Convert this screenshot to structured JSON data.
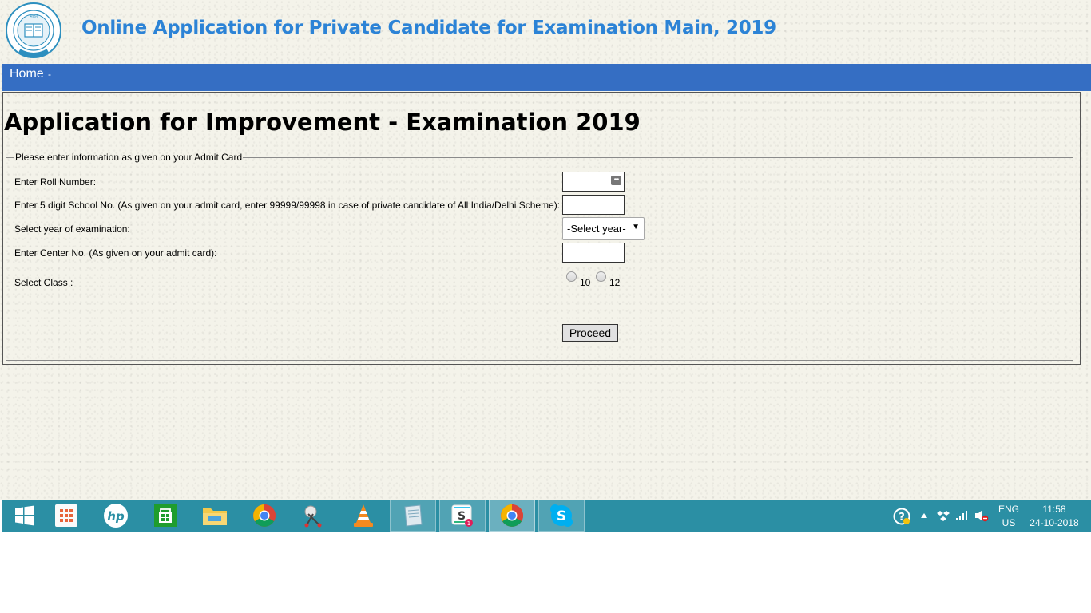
{
  "header": {
    "logo_text": "भारत",
    "title": "Online Application for Private Candidate for Examination Main, 2019"
  },
  "nav": {
    "home": "Home",
    "separator": "-"
  },
  "main": {
    "heading": "Application for Improvement - Examination 2019",
    "legend": "Please enter information as given on your Admit Card",
    "fields": {
      "roll_label": "Enter Roll Number:",
      "roll_value": "",
      "school_label": "Enter 5 digit School No. (As given on your admit card, enter 99999/99998 in case of private candidate of All India/Delhi Scheme):",
      "school_value": "",
      "year_label": "Select year of examination:",
      "year_selected": "-Select year-",
      "center_label": "Enter Center No. (As given on your admit card):",
      "center_value": "",
      "class_label": "Select Class :",
      "class_options": [
        "10",
        "12"
      ]
    },
    "proceed_label": "Proceed"
  },
  "taskbar": {
    "items": [
      "start",
      "apps",
      "hp",
      "store",
      "file-explorer",
      "chrome",
      "snipping-tool",
      "vlc",
      "notes",
      "slack",
      "chrome-active",
      "skype"
    ],
    "slack_badge": "1",
    "lang_top": "ENG",
    "lang_bottom": "US",
    "time": "11:58",
    "date": "24-10-2018"
  },
  "colors": {
    "title_blue": "#2c83d6",
    "nav_blue": "#356ec3",
    "taskbar": "#2b8fa4"
  }
}
